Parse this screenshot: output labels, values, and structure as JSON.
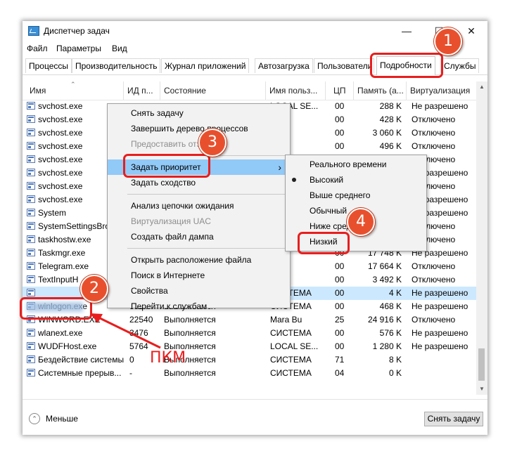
{
  "window": {
    "title": "Диспетчер задач",
    "controls": [
      "minimize-icon",
      "maximize-icon",
      "close-icon"
    ]
  },
  "menu": [
    "Файл",
    "Параметры",
    "Вид"
  ],
  "tabs": [
    "Процессы",
    "Производительность",
    "Журнал приложений",
    "Автозагрузка",
    "Пользователи",
    "Подробности",
    "Службы"
  ],
  "active_tab": "Подробности",
  "columns": [
    "Имя",
    "ИД п...",
    "Состояние",
    "Имя польз...",
    "ЦП",
    "Память (а...",
    "Виртуализация"
  ],
  "rows": [
    {
      "name": "svchost.exe",
      "pid": "",
      "state": "",
      "user": "LOCAL SE...",
      "cpu": "00",
      "mem": "288 K",
      "virt": "Не разрешено"
    },
    {
      "name": "svchost.exe",
      "pid": "",
      "state": "",
      "user": "Bu",
      "cpu": "00",
      "mem": "428 K",
      "virt": "Отключено"
    },
    {
      "name": "svchost.exe",
      "pid": "",
      "state": "",
      "user": "Bu",
      "cpu": "00",
      "mem": "3 060 K",
      "virt": "Отключено"
    },
    {
      "name": "svchost.exe",
      "pid": "",
      "state": "",
      "user": "Bu",
      "cpu": "00",
      "mem": "496 K",
      "virt": "Отключено"
    },
    {
      "name": "svchost.exe",
      "pid": "",
      "state": "",
      "user": "",
      "cpu": "",
      "mem": "",
      "virt": "Отключено"
    },
    {
      "name": "svchost.exe",
      "pid": "",
      "state": "",
      "user": "",
      "cpu": "",
      "mem": "",
      "virt": "Не разрешено"
    },
    {
      "name": "svchost.exe",
      "pid": "",
      "state": "",
      "user": "",
      "cpu": "",
      "mem": "",
      "virt": "Отключено"
    },
    {
      "name": "svchost.exe",
      "pid": "",
      "state": "",
      "user": "",
      "cpu": "",
      "mem": "",
      "virt": "Не разрешено"
    },
    {
      "name": "System",
      "pid": "",
      "state": "",
      "user": "",
      "cpu": "",
      "mem": "",
      "virt": "Не разрешено"
    },
    {
      "name": "SystemSettingsBro",
      "pid": "",
      "state": "",
      "user": "",
      "cpu": "",
      "mem": "",
      "virt": "Отключено"
    },
    {
      "name": "taskhostw.exe",
      "pid": "",
      "state": "",
      "user": "",
      "cpu": "",
      "mem": "",
      "virt": "Отключено"
    },
    {
      "name": "Taskmgr.exe",
      "pid": "",
      "state": "",
      "user": "Bu",
      "cpu": "00",
      "mem": "17 748 K",
      "virt": "Не разрешено"
    },
    {
      "name": "Telegram.exe",
      "pid": "",
      "state": "",
      "user": "Bu",
      "cpu": "00",
      "mem": "17 664 K",
      "virt": "Отключено"
    },
    {
      "name": "TextInputH",
      "pid": "",
      "state": "",
      "user": "Bu",
      "cpu": "00",
      "mem": "3 492 K",
      "virt": "Отключено"
    },
    {
      "name": "",
      "pid": "860",
      "state": "Выполняется",
      "user": "СИСТЕМА",
      "cpu": "00",
      "mem": "4 K",
      "virt": "Не разрешено",
      "selected": true
    },
    {
      "name": "winlogon.exe",
      "pid": "8524",
      "state": "Выполняется",
      "user": "СИСТЕМА",
      "cpu": "00",
      "mem": "468 K",
      "virt": "Не разрешено"
    },
    {
      "name": "WINWORD.EXE",
      "pid": "22540",
      "state": "Выполняется",
      "user": "Mara Bu",
      "cpu": "25",
      "mem": "24 916 K",
      "virt": "Отключено"
    },
    {
      "name": "wlanext.exe",
      "pid": "3476",
      "state": "Выполняется",
      "user": "СИСТЕМА",
      "cpu": "00",
      "mem": "576 K",
      "virt": "Не разрешено"
    },
    {
      "name": "WUDFHost.exe",
      "pid": "5764",
      "state": "Выполняется",
      "user": "LOCAL SE...",
      "cpu": "00",
      "mem": "1 280 K",
      "virt": "Не разрешено"
    },
    {
      "name": "Бездействие системы",
      "pid": "0",
      "state": "Выполняется",
      "user": "СИСТЕМА",
      "cpu": "71",
      "mem": "8 K",
      "virt": ""
    },
    {
      "name": "Системные прерыв...",
      "pid": "-",
      "state": "Выполняется",
      "user": "СИСТЕМА",
      "cpu": "04",
      "mem": "0 K",
      "virt": ""
    }
  ],
  "context_menu": [
    {
      "label": "Снять задачу",
      "disabled": false
    },
    {
      "label": "Завершить дерево процессов",
      "disabled": false
    },
    {
      "label": "Предоставить отз",
      "disabled": true
    },
    {
      "separator": true
    },
    {
      "label": "Задать приоритет",
      "disabled": false,
      "submenu": true,
      "highlighted": true
    },
    {
      "label": "Задать сходство",
      "disabled": false
    },
    {
      "separator": true
    },
    {
      "label": "Анализ цепочки ожидания",
      "disabled": false
    },
    {
      "label": "Виртуализация UAC",
      "disabled": true
    },
    {
      "label": "Создать файл дампа",
      "disabled": false
    },
    {
      "separator": true
    },
    {
      "label": "Открыть расположение файла",
      "disabled": false
    },
    {
      "label": "Поиск в Интернете",
      "disabled": false
    },
    {
      "label": "Свойства",
      "disabled": false
    },
    {
      "label": "Перейти к службам",
      "disabled": false
    }
  ],
  "priority_menu": [
    {
      "label": "Реального времени",
      "checked": false
    },
    {
      "label": "Высокий",
      "checked": true
    },
    {
      "label": "Выше среднего",
      "checked": false
    },
    {
      "label": "Обычный",
      "checked": false
    },
    {
      "label": "Ниже сред",
      "checked": false
    },
    {
      "label": "Низкий",
      "checked": false
    }
  ],
  "footer": {
    "less": "Меньше",
    "end_task": "Снять задачу"
  },
  "annotations": {
    "badges": [
      "1",
      "2",
      "3",
      "4"
    ],
    "pkm": "ПКМ",
    "accent": "#e81e1e",
    "badge_color": "#e8502d"
  }
}
